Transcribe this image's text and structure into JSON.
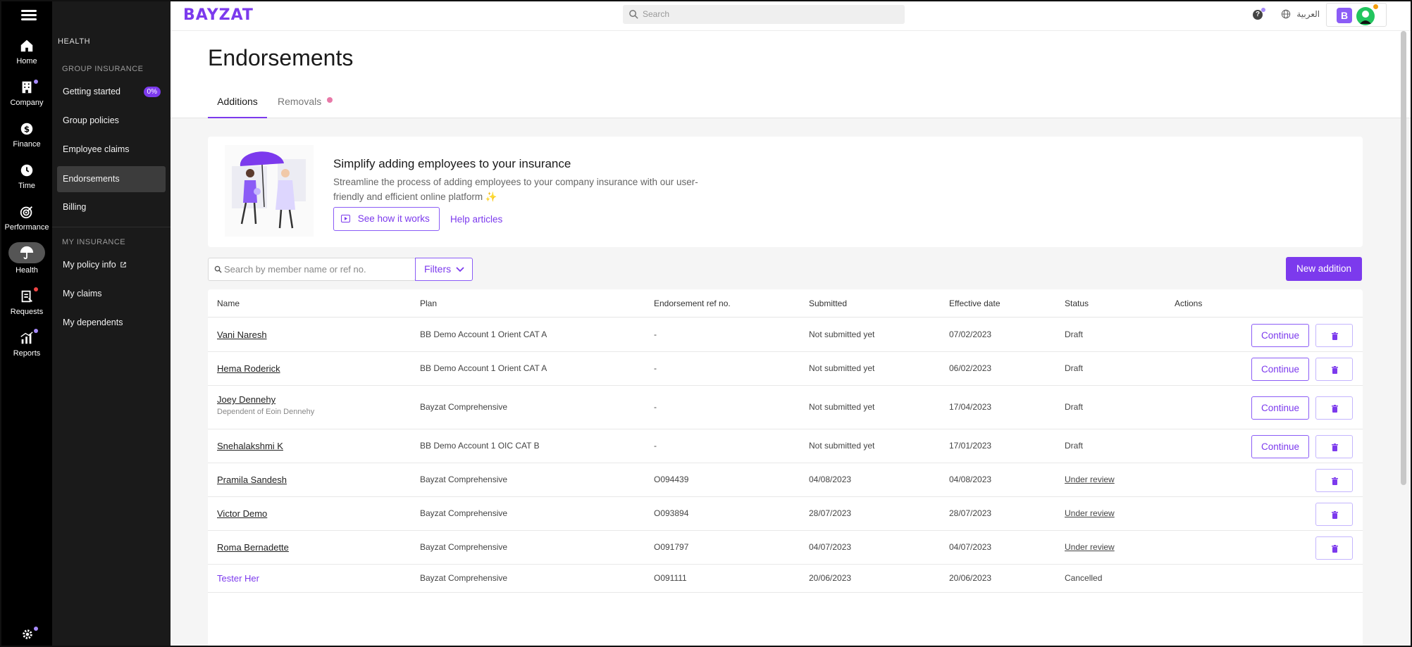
{
  "app": {
    "logo": "BAYZAT"
  },
  "rail": {
    "items": [
      {
        "label": "Home",
        "icon": "home-icon"
      },
      {
        "label": "Company",
        "icon": "building-icon"
      },
      {
        "label": "Finance",
        "icon": "dollar-icon"
      },
      {
        "label": "Time",
        "icon": "clock-icon"
      },
      {
        "label": "Performance",
        "icon": "target-icon"
      },
      {
        "label": "Health",
        "icon": "umbrella-icon"
      },
      {
        "label": "Requests",
        "icon": "clipboard-icon"
      },
      {
        "label": "Reports",
        "icon": "chart-icon"
      }
    ],
    "active": "Health"
  },
  "sidebar": {
    "heading": "HEALTH",
    "group_section": "GROUP INSURANCE",
    "group_items": [
      {
        "label": "Getting started",
        "badge": "0%"
      },
      {
        "label": "Group policies"
      },
      {
        "label": "Employee claims"
      },
      {
        "label": "Endorsements"
      },
      {
        "label": "Billing"
      }
    ],
    "my_section": "MY INSURANCE",
    "my_items": [
      {
        "label": "My policy info"
      },
      {
        "label": "My claims"
      },
      {
        "label": "My dependents"
      }
    ]
  },
  "topbar": {
    "search_placeholder": "Search",
    "language": "العربية",
    "brand_letter": "B"
  },
  "page": {
    "title": "Endorsements",
    "tabs": [
      {
        "label": "Additions",
        "active": true
      },
      {
        "label": "Removals",
        "active": false
      }
    ]
  },
  "promo": {
    "title": "Simplify adding employees to your insurance",
    "description": "Streamline the process of adding employees to your company insurance with our user-friendly and efficient online platform ✨",
    "video_button": "See how it works",
    "help_link": "Help articles"
  },
  "toolbar": {
    "search_placeholder": "Search by member name or ref no.",
    "filters_label": "Filters",
    "new_button": "New addition"
  },
  "table": {
    "headers": [
      "Name",
      "Plan",
      "Endorsement ref no.",
      "Submitted",
      "Effective date",
      "Status",
      "Actions"
    ],
    "continue_label": "Continue",
    "rows": [
      {
        "name": "Vani Naresh",
        "sub": "",
        "plan": "BB Demo Account 1 Orient CAT A",
        "ref": "-",
        "submitted": "Not submitted yet",
        "effective": "07/02/2023",
        "status": "Draft",
        "status_link": false,
        "continue": true
      },
      {
        "name": "Hema Roderick",
        "sub": "",
        "plan": "BB Demo Account 1 Orient CAT A",
        "ref": "-",
        "submitted": "Not submitted yet",
        "effective": "06/02/2023",
        "status": "Draft",
        "status_link": false,
        "continue": true
      },
      {
        "name": "Joey Dennehy",
        "sub": "Dependent of Eoin Dennehy",
        "plan": "Bayzat Comprehensive",
        "ref": "-",
        "submitted": "Not submitted yet",
        "effective": "17/04/2023",
        "status": "Draft",
        "status_link": false,
        "continue": true
      },
      {
        "name": "Snehalakshmi K",
        "sub": "",
        "plan": "BB Demo Account 1 OIC CAT B",
        "ref": "-",
        "submitted": "Not submitted yet",
        "effective": "17/01/2023",
        "status": "Draft",
        "status_link": false,
        "continue": true
      },
      {
        "name": "Pramila Sandesh",
        "sub": "",
        "plan": "Bayzat Comprehensive",
        "ref": "O094439",
        "submitted": "04/08/2023",
        "effective": "04/08/2023",
        "status": "Under review",
        "status_link": true,
        "continue": false
      },
      {
        "name": "Victor Demo",
        "sub": "",
        "plan": "Bayzat Comprehensive",
        "ref": "O093894",
        "submitted": "28/07/2023",
        "effective": "28/07/2023",
        "status": "Under review",
        "status_link": true,
        "continue": false
      },
      {
        "name": "Roma Bernadette",
        "sub": "",
        "plan": "Bayzat Comprehensive",
        "ref": "O091797",
        "submitted": "04/07/2023",
        "effective": "04/07/2023",
        "status": "Under review",
        "status_link": true,
        "continue": false
      },
      {
        "name": "Tester Her",
        "sub": "",
        "plan": "Bayzat Comprehensive",
        "ref": "O091111",
        "submitted": "20/06/2023",
        "effective": "20/06/2023",
        "status": "Cancelled",
        "status_link": false,
        "continue": false
      }
    ]
  },
  "colors": {
    "accent": "#7c3aed",
    "rail_bg": "#000000",
    "sidebar_bg": "#1a1a1a",
    "main_bg": "#f5f5f5"
  }
}
